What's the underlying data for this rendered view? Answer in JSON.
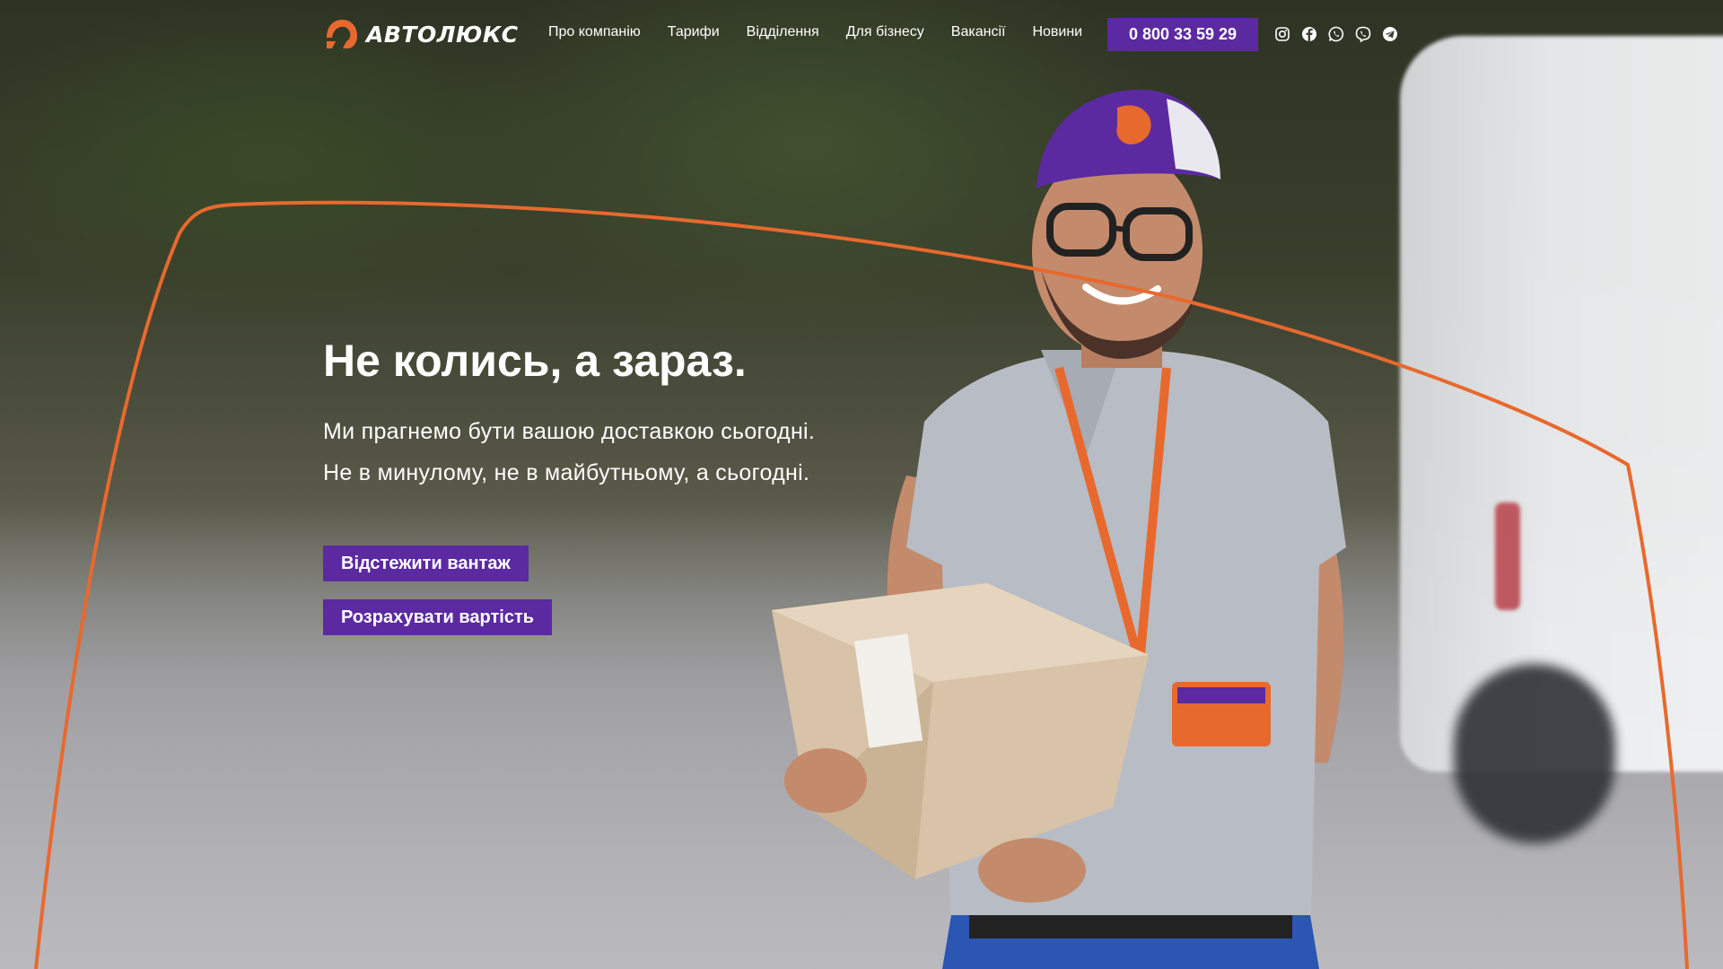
{
  "header": {
    "brand": "АВТОЛЮКС",
    "nav": [
      {
        "label": "Про компанію"
      },
      {
        "label": "Тарифи"
      },
      {
        "label": "Відділення"
      },
      {
        "label": "Для бізнесу"
      },
      {
        "label": "Вакансії"
      },
      {
        "label": "Новини"
      }
    ],
    "phone": "0 800 33 59 29",
    "socials": [
      {
        "icon": "instagram-icon"
      },
      {
        "icon": "facebook-icon"
      },
      {
        "icon": "whatsapp-icon"
      },
      {
        "icon": "viber-icon"
      },
      {
        "icon": "telegram-icon"
      }
    ]
  },
  "hero": {
    "title": "Не колись, а зараз.",
    "subtitle_lines": [
      "Ми прагнемо бути вашою доставкою сьогодні.",
      "Не в минулому, не в майбутньому, а сьогодні."
    ],
    "track_button": "Відстежити вантаж",
    "calculate_button": "Розрахувати вартість"
  },
  "colors": {
    "accent_orange": "#e8692e",
    "brand_purple": "#5b2aa1",
    "text_white": "#ffffff"
  }
}
